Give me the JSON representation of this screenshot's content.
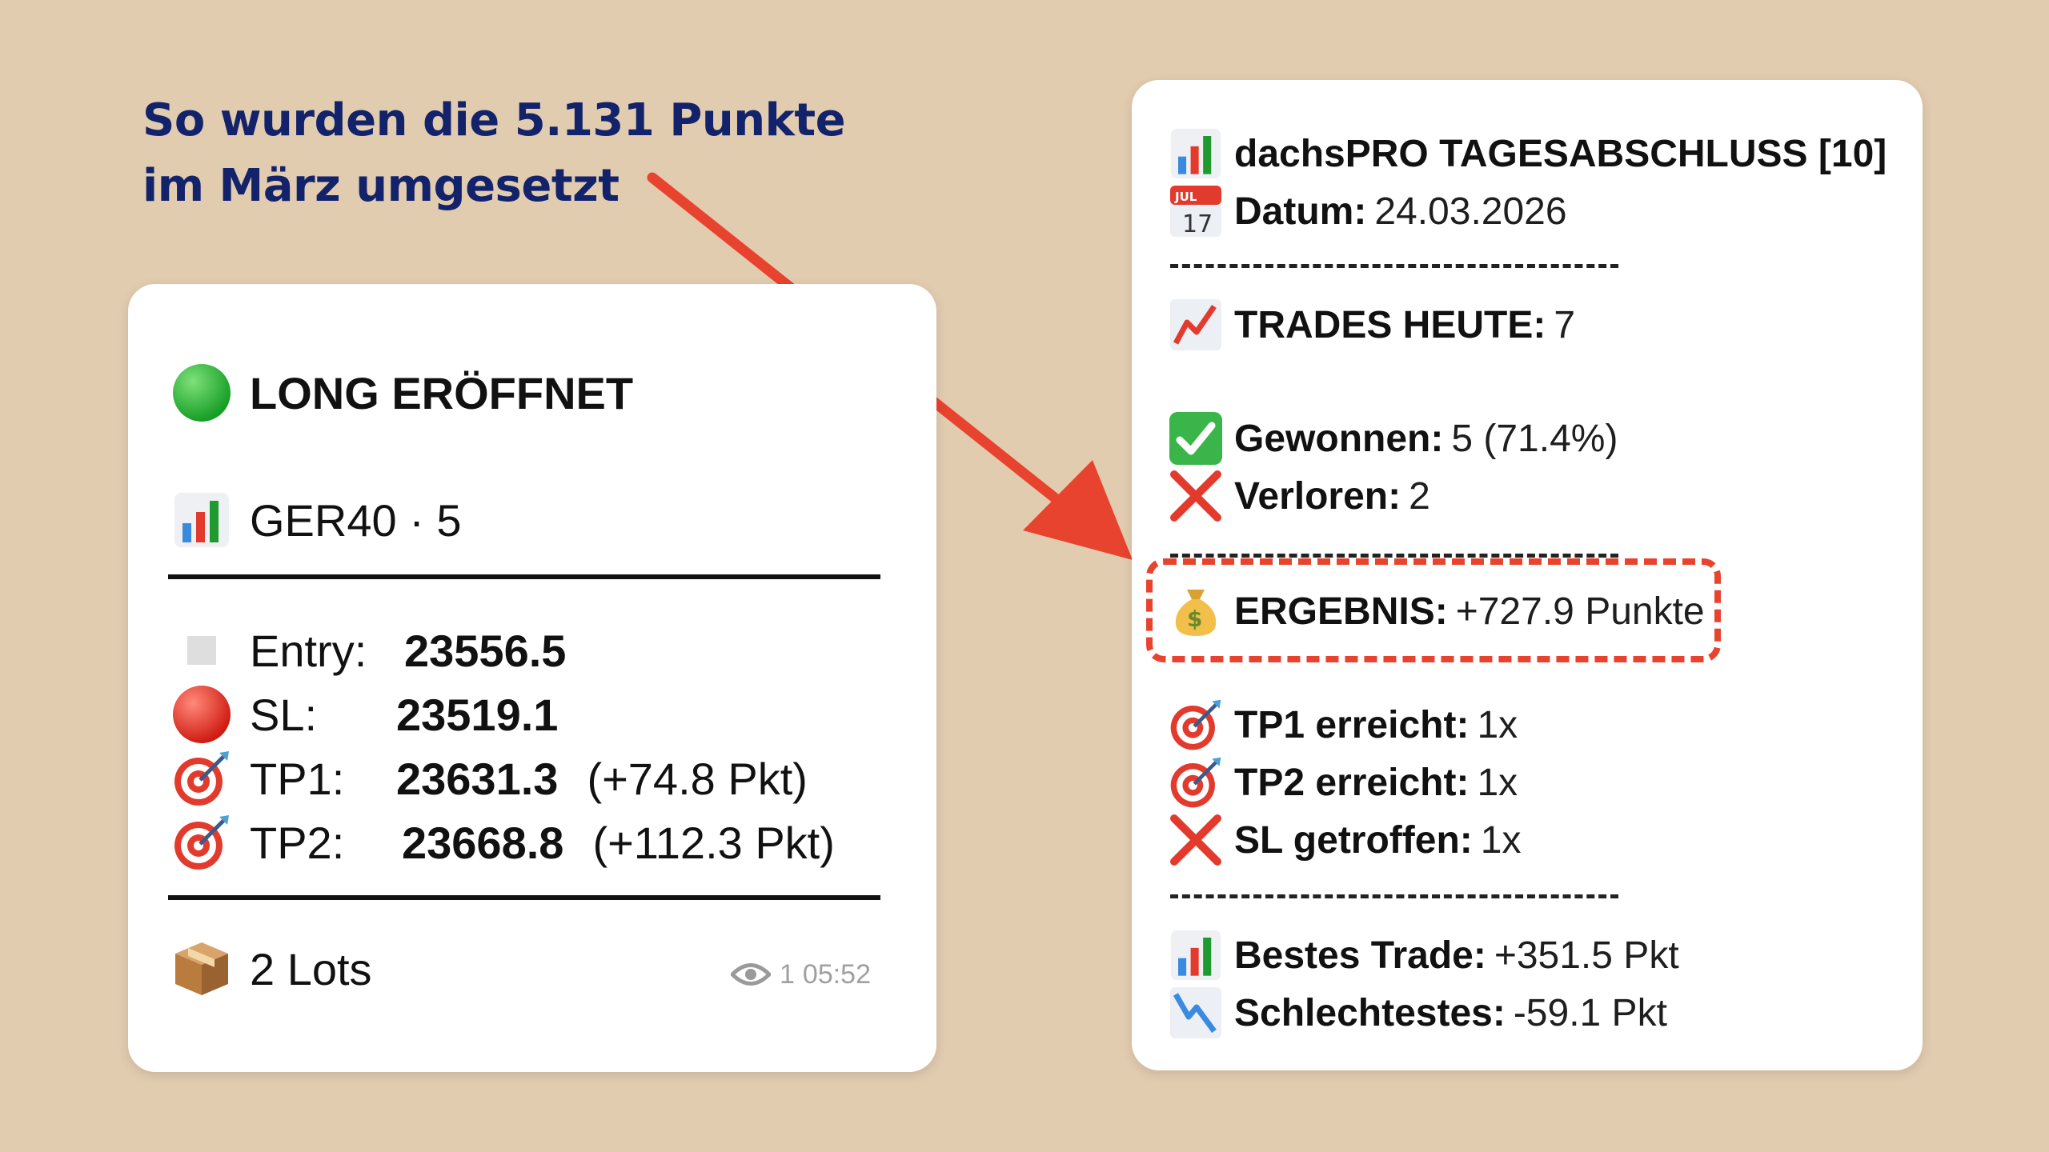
{
  "headline": {
    "line1": "So wurden die 5.131 Punkte",
    "line2": "im März umgesetzt"
  },
  "signal": {
    "title": "LONG ERÖFFNET",
    "instrument": "GER40 · 5",
    "entry_label": "Entry:",
    "entry_value": "23556.5",
    "sl_label": "SL:",
    "sl_value": "23519.1",
    "tp1_label": "TP1:",
    "tp1_value": "23631.3",
    "tp1_diff": "(+74.8 Pkt)",
    "tp2_label": "TP2:",
    "tp2_value": "23668.8",
    "tp2_diff": "(+112.3 Pkt)",
    "lots": "2 Lots",
    "views": "1",
    "time": "05:52"
  },
  "summary": {
    "title": "dachsPRO TAGESABSCHLUSS [10]",
    "date_label": "Datum:",
    "date_value": "24.03.2026",
    "calendar_month": "JUL",
    "calendar_day": "17",
    "trades_label": "TRADES HEUTE:",
    "trades_value": "7",
    "won_label": "Gewonnen:",
    "won_value": "5 (71.4%)",
    "lost_label": "Verloren:",
    "lost_value": "2",
    "result_label": "ERGEBNIS:",
    "result_value": "+727.9 Punkte",
    "tp1_label": "TP1 erreicht:",
    "tp1_value": "1x",
    "tp2_label": "TP2 erreicht:",
    "tp2_value": "1x",
    "sl_label": "SL getroffen:",
    "sl_value": "1x",
    "best_label": "Bestes Trade:",
    "best_value": "+351.5 Pkt",
    "worst_label": "Schlechtestes:",
    "worst_value": "-59.1 Pkt"
  },
  "colors": {
    "background": "#e2ccb0",
    "headline": "#13236b",
    "accent_red": "#e8432e",
    "green_circle": "#21b530",
    "red_circle": "#e1261c"
  },
  "icons": [
    "green-circle-icon",
    "bar-chart-icon",
    "white-square-icon",
    "red-circle-icon",
    "target-icon",
    "package-icon",
    "eye-icon",
    "calendar-icon",
    "chart-increasing-icon",
    "check-mark-icon",
    "cross-mark-icon",
    "money-bag-icon",
    "chart-decreasing-icon"
  ]
}
